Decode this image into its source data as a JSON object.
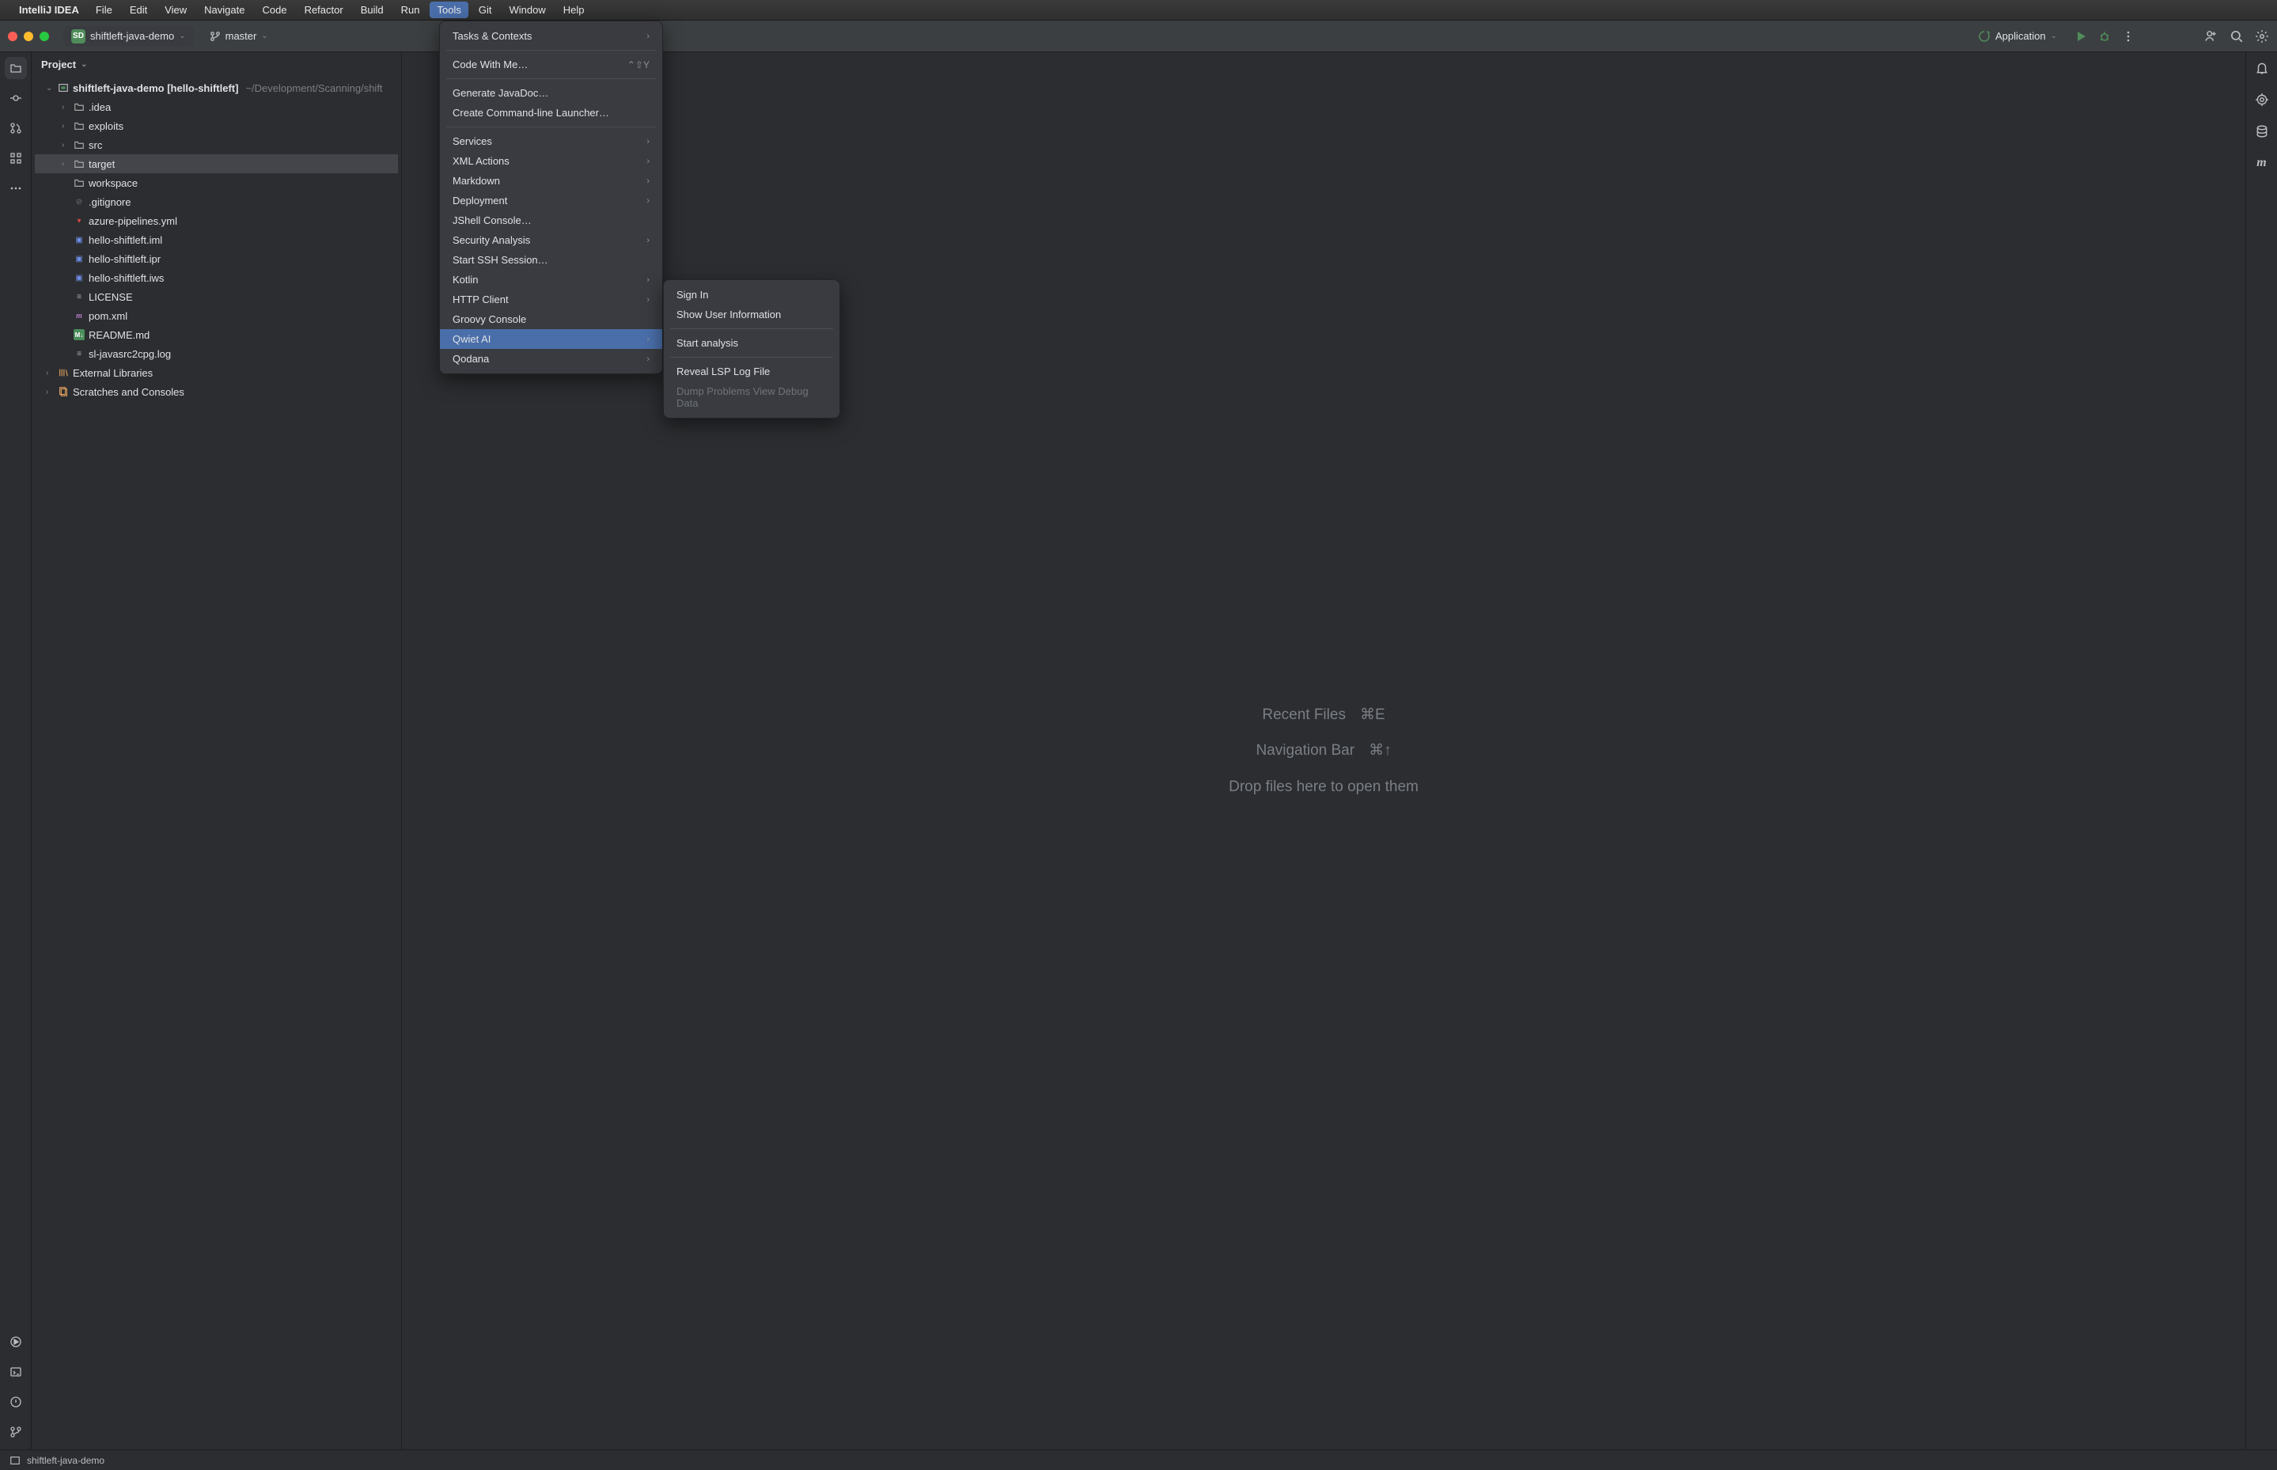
{
  "menubar": {
    "appname": "IntelliJ IDEA",
    "items": [
      "File",
      "Edit",
      "View",
      "Navigate",
      "Code",
      "Refactor",
      "Build",
      "Run",
      "Tools",
      "Git",
      "Window",
      "Help"
    ],
    "active_index": 8
  },
  "toolbar": {
    "project_badge": "SD",
    "project_name": "shiftleft-java-demo",
    "branch": "master",
    "run_config": "Application"
  },
  "sidebar": {
    "title": "Project"
  },
  "tree": {
    "root_name": "shiftleft-java-demo",
    "root_suffix": "[hello-shiftleft]",
    "root_path": "~/Development/Scanning/shift",
    "children": [
      {
        "name": ".idea",
        "type": "folder",
        "expandable": true
      },
      {
        "name": "exploits",
        "type": "folder",
        "expandable": true
      },
      {
        "name": "src",
        "type": "folder",
        "expandable": true
      },
      {
        "name": "target",
        "type": "folder",
        "expandable": true,
        "selected": true
      },
      {
        "name": "workspace",
        "type": "folder",
        "expandable": false
      },
      {
        "name": ".gitignore",
        "type": "file",
        "icon": "idea"
      },
      {
        "name": "azure-pipelines.yml",
        "type": "file",
        "icon": "yml"
      },
      {
        "name": "hello-shiftleft.iml",
        "type": "file",
        "icon": "iml"
      },
      {
        "name": "hello-shiftleft.ipr",
        "type": "file",
        "icon": "iml"
      },
      {
        "name": "hello-shiftleft.iws",
        "type": "file",
        "icon": "iml"
      },
      {
        "name": "LICENSE",
        "type": "file",
        "icon": "txt"
      },
      {
        "name": "pom.xml",
        "type": "file",
        "icon": "pom"
      },
      {
        "name": "README.md",
        "type": "file",
        "icon": "md"
      },
      {
        "name": "sl-javasrc2cpg.log",
        "type": "file",
        "icon": "txt"
      }
    ],
    "external_libraries": "External Libraries",
    "scratches": "Scratches and Consoles"
  },
  "editor_hints": {
    "recent_files_label": "Recent Files",
    "recent_files_kbd": "⌘E",
    "nav_bar_label": "Navigation Bar",
    "nav_bar_kbd": "⌘↑",
    "drop_hint": "Drop files here to open them"
  },
  "tools_menu": [
    {
      "label": "Tasks & Contexts",
      "submenu": true
    },
    {
      "separator": true
    },
    {
      "label": "Code With Me…",
      "shortcut": "⌃⇧Y"
    },
    {
      "separator": true
    },
    {
      "label": "Generate JavaDoc…"
    },
    {
      "label": "Create Command-line Launcher…"
    },
    {
      "separator": true
    },
    {
      "label": "Services",
      "submenu": true
    },
    {
      "label": "XML Actions",
      "submenu": true
    },
    {
      "label": "Markdown",
      "submenu": true
    },
    {
      "label": "Deployment",
      "submenu": true
    },
    {
      "label": "JShell Console…"
    },
    {
      "label": "Security Analysis",
      "submenu": true
    },
    {
      "label": "Start SSH Session…"
    },
    {
      "label": "Kotlin",
      "submenu": true
    },
    {
      "label": "HTTP Client",
      "submenu": true
    },
    {
      "label": "Groovy Console"
    },
    {
      "label": "Qwiet AI",
      "submenu": true,
      "highlighted": true
    },
    {
      "label": "Qodana",
      "submenu": true
    }
  ],
  "qwiet_submenu": [
    {
      "label": "Sign In"
    },
    {
      "label": "Show User Information"
    },
    {
      "separator": true
    },
    {
      "label": "Start analysis"
    },
    {
      "separator": true
    },
    {
      "label": "Reveal LSP Log File"
    },
    {
      "label": "Dump Problems View Debug Data",
      "disabled": true
    }
  ],
  "statusbar": {
    "module": "shiftleft-java-demo"
  }
}
